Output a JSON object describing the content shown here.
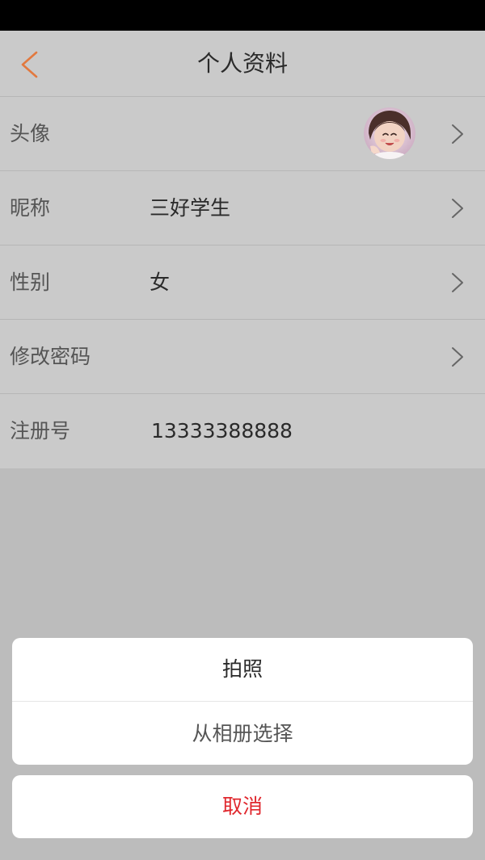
{
  "nav": {
    "title": "个人资料",
    "back_icon": "chevron-left-icon",
    "accent_color": "#e2793f"
  },
  "profile": {
    "avatar_label": "头像",
    "nickname_label": "昵称",
    "nickname_value": "三好学生",
    "gender_label": "性别",
    "gender_value": "女",
    "password_label": "修改密码",
    "register_label": "注册号",
    "register_value": "13333388888"
  },
  "action_sheet": {
    "take_photo": "拍照",
    "choose_album": "从相册选择",
    "cancel": "取消",
    "cancel_color": "#e0282e"
  }
}
